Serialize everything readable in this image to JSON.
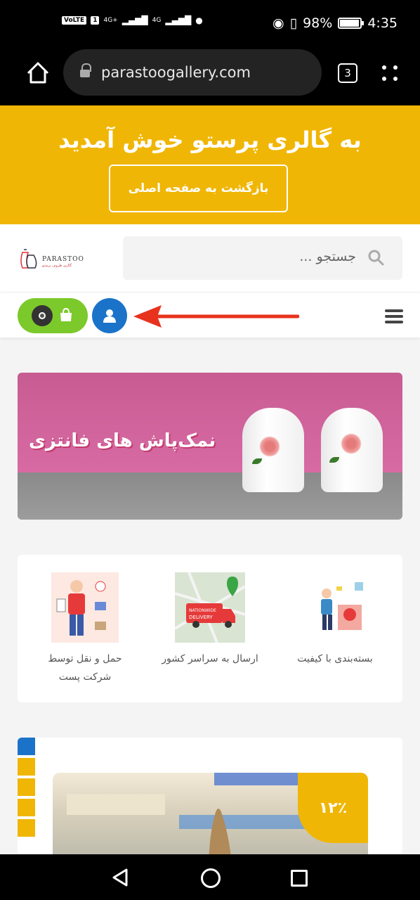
{
  "status_bar": {
    "left_chip": "VoLTE",
    "sim": "1",
    "signal_1": "4G+",
    "signal_2": "4G",
    "battery": "98%",
    "battery_level": 0.98,
    "time": "4:35"
  },
  "browser": {
    "url": "parastoogallery.com",
    "tab_count": "3"
  },
  "welcome_banner": {
    "title": "به گالری پرستو خوش آمدید",
    "button_label": "بازگشت به صفحه اصلی"
  },
  "header": {
    "logo_name": "PARASTOO",
    "logo_tagline": "گالری ظروف پرستو",
    "search_placeholder": "جستجو ..."
  },
  "toolbar": {
    "cart_count": "0"
  },
  "promo_banner": {
    "title": "نمک‌پاش های فانتزی"
  },
  "features": [
    {
      "label": "بسته‌بندی با کیفیت",
      "icon": "packaging-icon"
    },
    {
      "label": "ارسال به سراسر کشور",
      "icon": "delivery-truck-icon"
    },
    {
      "label": "حمل و نقل توسط شرکت پست",
      "icon": "courier-icon"
    }
  ],
  "product": {
    "discount": "۱۲٪"
  },
  "colors": {
    "banner_yellow": "#f0b605",
    "cart_green": "#7cc92b",
    "user_blue": "#1a73c9",
    "arrow_red": "#e8321e"
  }
}
